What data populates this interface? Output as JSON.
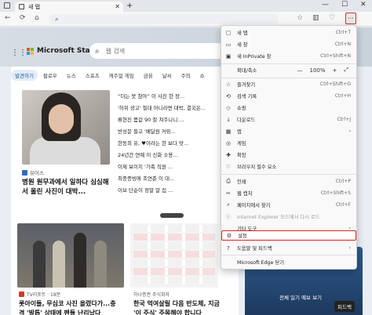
{
  "browser": {
    "tab_title": "새 탭",
    "new_tab_symbol": "+",
    "address_value": "",
    "minimize": "—",
    "maximize": "☐",
    "close": "✕",
    "more": "···"
  },
  "page": {
    "brand": "Microsoft Start",
    "search_placeholder": "웹 검색",
    "categories": [
      "발견하기",
      "팔로우",
      "뉴스",
      "스포츠",
      "캐주얼 게임",
      "금융",
      "날씨",
      "주의",
      "쇼"
    ],
    "hero": {
      "source": "뷰어스",
      "title": "병원 원무과에서 일하다 심심해서 올린 사진이 대박..."
    },
    "headlines": [
      "“더는 못 참아” 이 사진 한 장...",
      "'허위 광고' 절대 아니라면 대박, 결국은...",
      "류현진 몸값 90 잘 쳐주나니 ...",
      "반성문 들고 '배달원 커밍...",
      "한동희 유, ♥이라는 한 보다 맛...",
      "24년간 연예 이 신화 소용...",
      "이제 보이지 '가족 직원 ...",
      "최종증빙에 조연준 이 대...",
      "이브 단순이 정말 알 집 ..."
    ],
    "cards": [
      {
        "source": "TV리포트 · 18분",
        "title": "롯아이들, 무심코 사진 올렸다가...충격 '발톱' 상태에 팬들 난리났다",
        "likes": "1"
      },
      {
        "source": "하나증권 주식회자",
        "title": "한국 먹여살릴 다음 반도체, 지금 '이 주식' 주목해야 합니다",
        "meta": "AD"
      }
    ],
    "weather_caption": "전체 일기 예보 보기",
    "feedback": "피드백"
  },
  "menu": {
    "items": [
      {
        "label": "새 탭",
        "shortcut": "Ctrl+T",
        "icon": "new-tab-icon",
        "glyph": "▢"
      },
      {
        "label": "새 창",
        "shortcut": "Ctrl+N",
        "icon": "new-window-icon",
        "glyph": "▭"
      },
      {
        "label": "새 InPrivate 창",
        "shortcut": "Ctrl+Shift+N",
        "icon": "inprivate-icon",
        "glyph": "▣"
      },
      {
        "label": "확대/축소",
        "zoom_value": "100%",
        "zoom_minus": "—",
        "zoom_plus": "+",
        "zoom_full": "⤢",
        "icon": "zoom-icon",
        "glyph": ""
      },
      {
        "label": "즐겨찾기",
        "shortcut": "Ctrl+Shift+O",
        "icon": "favorites-icon",
        "glyph": "☆"
      },
      {
        "label": "검색 기록",
        "shortcut": "Ctrl+H",
        "icon": "history-icon",
        "glyph": "⟲"
      },
      {
        "label": "쇼핑",
        "shortcut": "",
        "icon": "shopping-icon",
        "glyph": "◇"
      },
      {
        "label": "다운로드",
        "shortcut": "Ctrl+J",
        "icon": "downloads-icon",
        "glyph": "⤓"
      },
      {
        "label": "앱",
        "shortcut": "",
        "icon": "apps-icon",
        "glyph": "▦"
      },
      {
        "label": "게임",
        "shortcut": "",
        "icon": "games-icon",
        "glyph": "◎"
      },
      {
        "label": "확장",
        "shortcut": "",
        "icon": "extensions-icon",
        "glyph": "✚"
      },
      {
        "label": "브라우저 필수 요소",
        "shortcut": "",
        "icon": "essentials-icon",
        "glyph": "♡"
      },
      {
        "label": "인쇄",
        "shortcut": "Ctrl+P",
        "icon": "print-icon",
        "glyph": "⎙"
      },
      {
        "label": "웹 캡처",
        "shortcut": "Ctrl+Shift+S",
        "icon": "web-capture-icon",
        "glyph": "✂"
      },
      {
        "label": "페이지에서 찾기",
        "shortcut": "Ctrl+F",
        "icon": "find-icon",
        "glyph": "⌕"
      },
      {
        "label": "Internet Explorer 모드에서 다시 로드",
        "shortcut": "",
        "icon": "ie-mode-icon",
        "glyph": "ⓔ"
      },
      {
        "label": "기타 도구",
        "shortcut": "",
        "icon": "more-tools-icon",
        "glyph": ""
      },
      {
        "label": "설정",
        "shortcut": "",
        "icon": "settings-icon",
        "glyph": "⚙"
      },
      {
        "label": "도움말 및 피드백",
        "shortcut": "",
        "icon": "help-icon",
        "glyph": "?"
      },
      {
        "label": "Microsoft Edge 닫기",
        "shortcut": "",
        "icon": "close-edge-icon",
        "glyph": ""
      }
    ],
    "submenu_arrow": "›"
  }
}
